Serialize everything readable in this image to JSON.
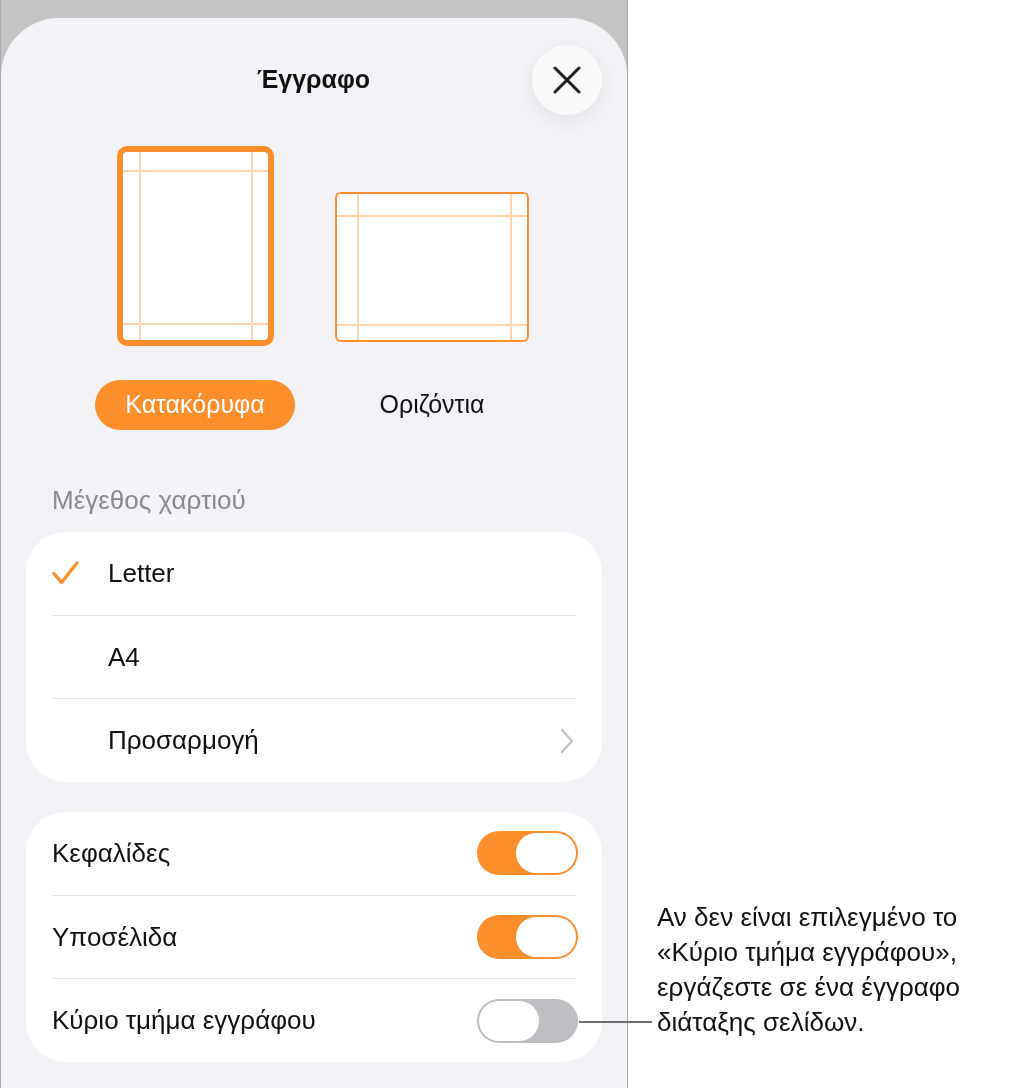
{
  "sheet": {
    "title": "Έγγραφο"
  },
  "orientations": [
    {
      "kind": "portrait",
      "label": "Κατακόρυφα",
      "selected": true
    },
    {
      "kind": "landscape",
      "label": "Οριζόντια",
      "selected": false
    }
  ],
  "paper_size": {
    "header": "Μέγεθος χαρτιού",
    "items": [
      {
        "kind": "option",
        "label": "Letter",
        "selected": true
      },
      {
        "kind": "option",
        "label": "A4",
        "selected": false
      },
      {
        "kind": "submenu",
        "label": "Προσαρμογή",
        "selected": false
      }
    ]
  },
  "toggles": [
    {
      "label": "Κεφαλίδες",
      "on": true
    },
    {
      "label": "Υποσέλιδα",
      "on": true
    },
    {
      "label": "Κύριο τμήμα εγγράφου",
      "on": false
    }
  ],
  "callout": {
    "text": "Αν δεν είναι επιλεγμένο το «Κύριο τμήμα εγγράφου», εργάζεστε σε ένα έγγραφο διάταξης σελίδων."
  }
}
